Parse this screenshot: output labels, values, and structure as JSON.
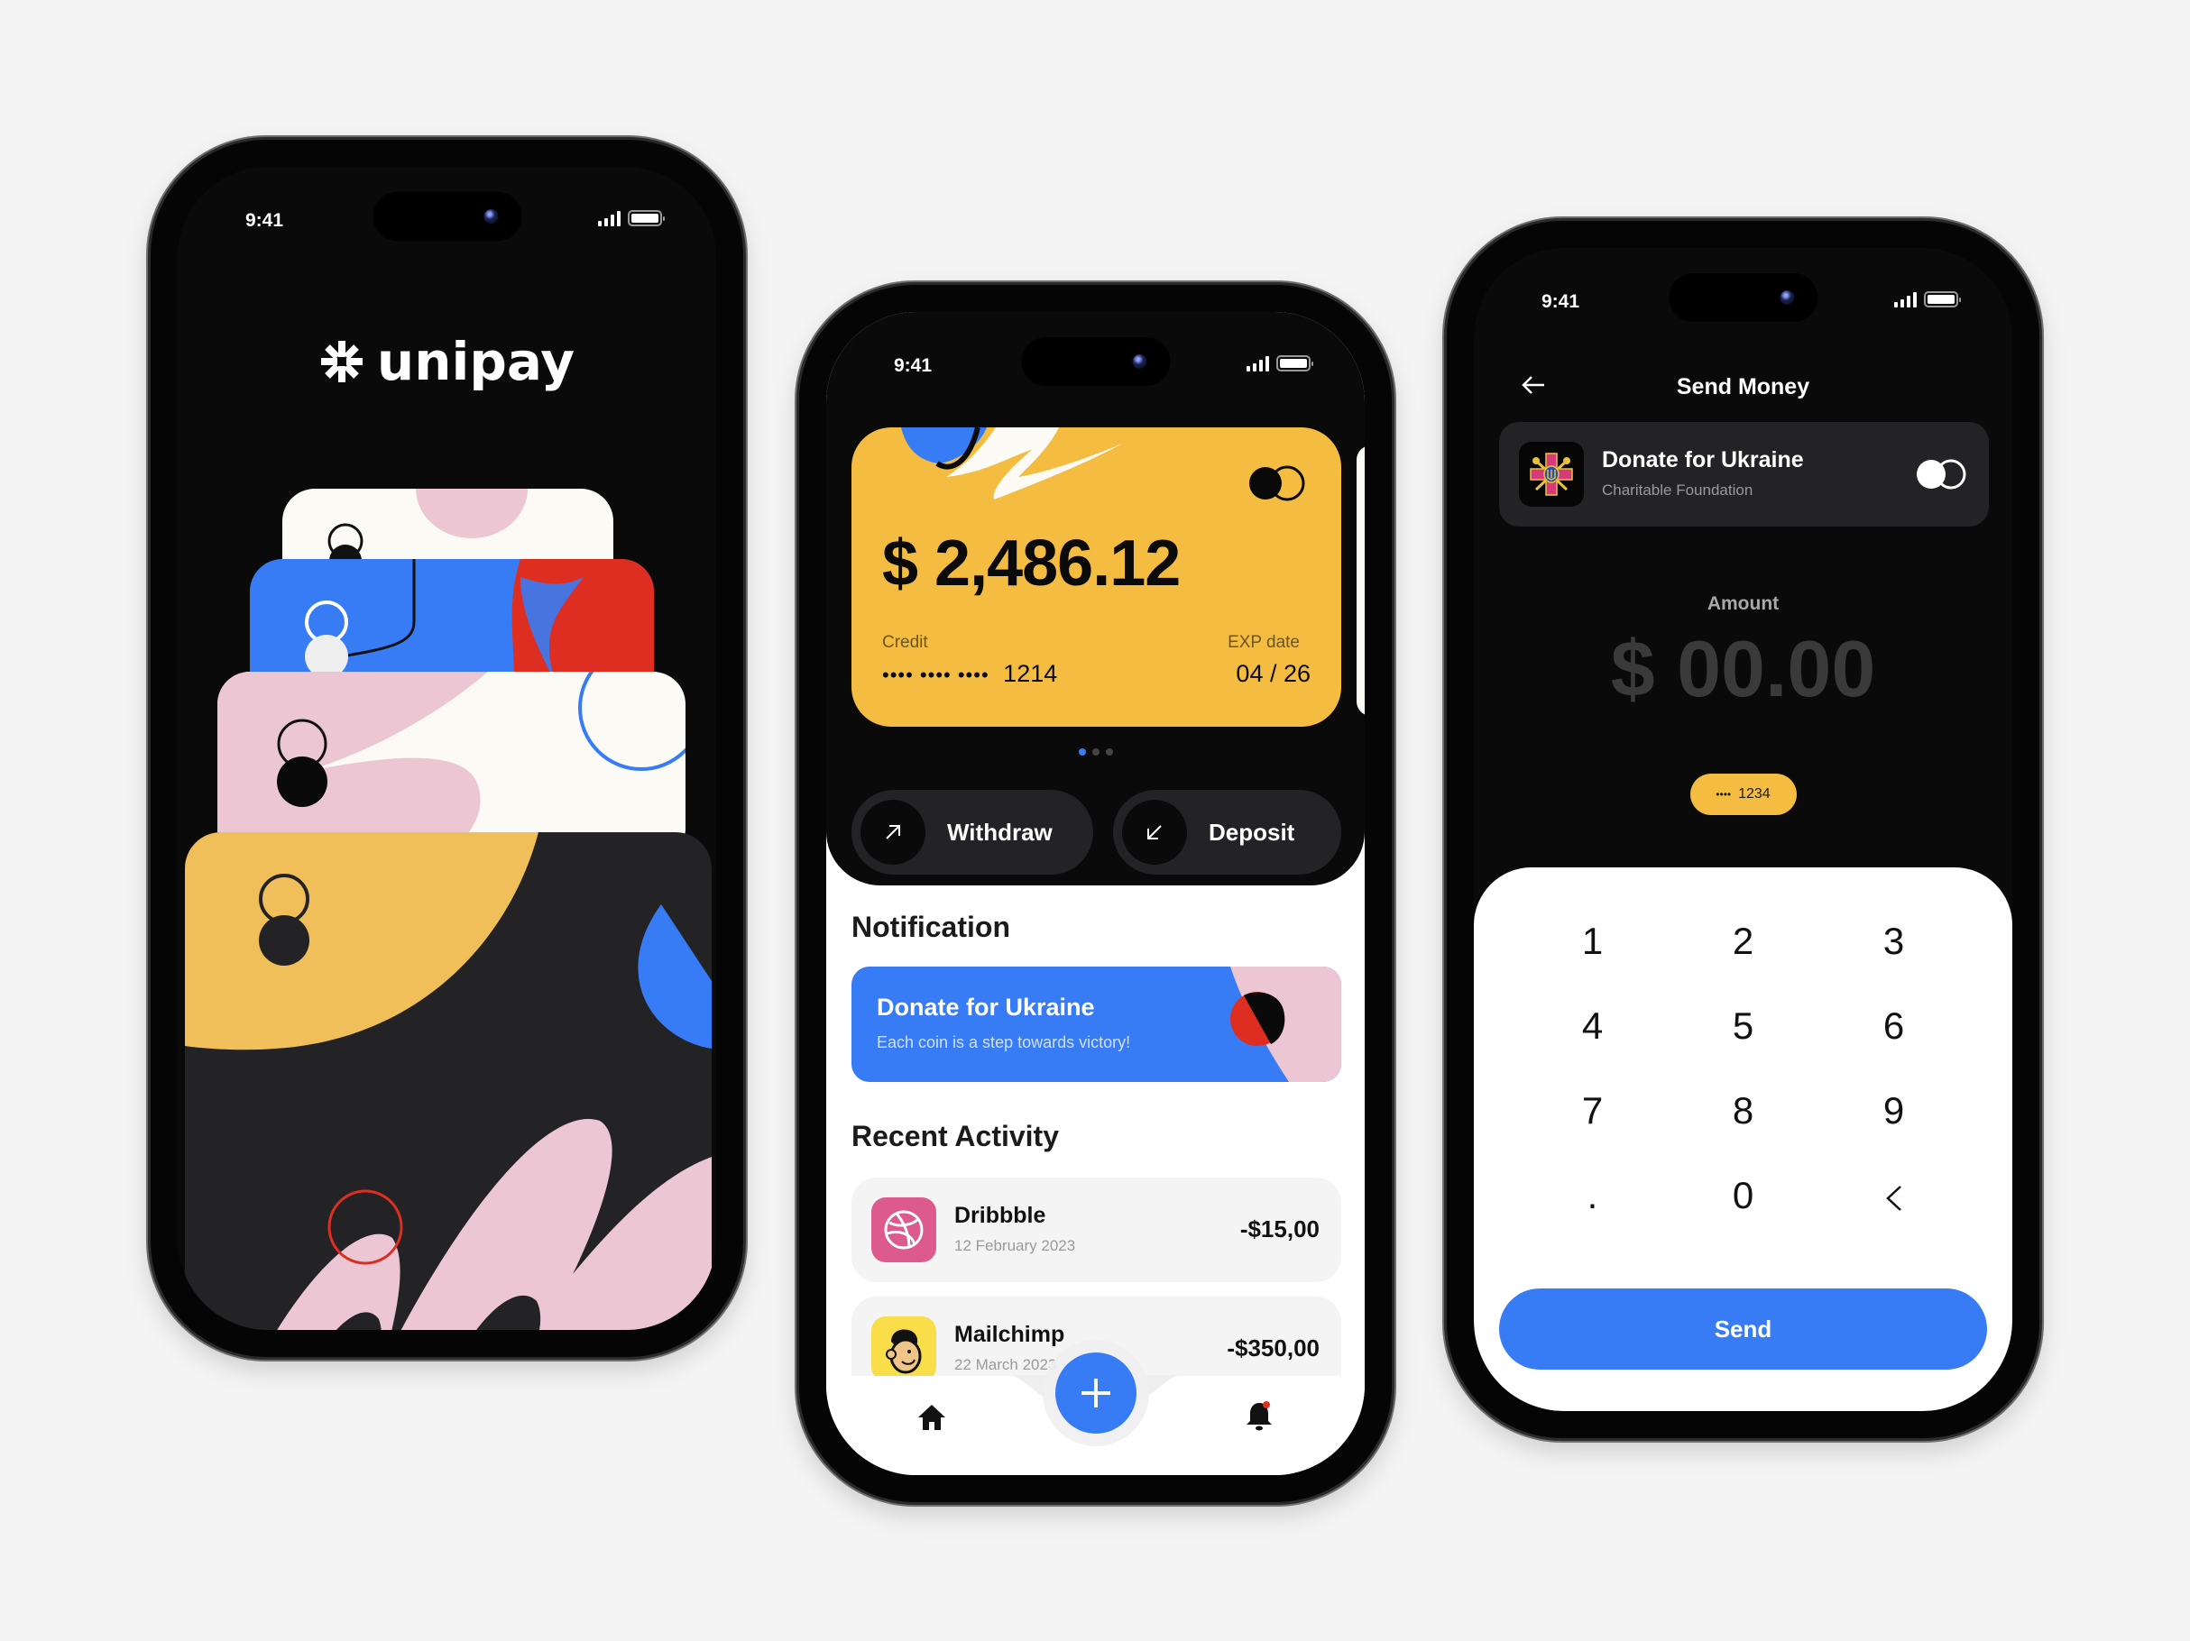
{
  "status_bar": {
    "time": "9:41"
  },
  "splash": {
    "brand_name": "unipay",
    "colors": {
      "yellow": "#f0bf5a",
      "blue": "#377cf4",
      "red": "#dd2e21",
      "pink": "#ecc7d3",
      "cream": "#fcfaf4",
      "dark": "#232325"
    }
  },
  "home": {
    "balance_card": {
      "amount": "$ 2,486.12",
      "type_label": "Credit",
      "masked_number": "•••• •••• ••••",
      "last_digits": "1214",
      "exp_label": "EXP date",
      "exp_value": "04 / 26",
      "pages": 3,
      "active_page": 1
    },
    "actions": [
      {
        "label": "Withdraw",
        "icon": "arrow-up-right-icon"
      },
      {
        "label": "Deposit",
        "icon": "arrow-down-left-icon"
      }
    ],
    "notification_section": "Notification",
    "notification": {
      "title": "Donate for Ukraine",
      "subtitle": "Each coin is a step towards victory!"
    },
    "activity_section": "Recent Activity",
    "activities": [
      {
        "name": "Dribbble",
        "date": "12 February 2023",
        "amount": "-$15,00",
        "icon": "dribbble-icon",
        "icon_bg": "#dd5a8c"
      },
      {
        "name": "Mailchimp",
        "date": "22 March 2023",
        "amount": "-$350,00",
        "icon": "mailchimp-icon",
        "icon_bg": "#f9de4a"
      }
    ],
    "nav": [
      {
        "label": "Home",
        "icon": "home-icon"
      },
      {
        "label": "Add",
        "icon": "plus-icon"
      },
      {
        "label": "Notifications",
        "icon": "bell-icon",
        "badge": true
      }
    ]
  },
  "send": {
    "title": "Send Money",
    "recipient": {
      "name": "Donate for Ukraine",
      "subtitle": "Charitable Foundation"
    },
    "amount_label": "Amount",
    "amount_value": "$ 00.00",
    "card_chip": {
      "masked": "••••",
      "last_digits": "1234"
    },
    "keys": [
      "1",
      "2",
      "3",
      "4",
      "5",
      "6",
      "7",
      "8",
      "9",
      ".",
      "0",
      "‹"
    ],
    "send_label": "Send"
  }
}
